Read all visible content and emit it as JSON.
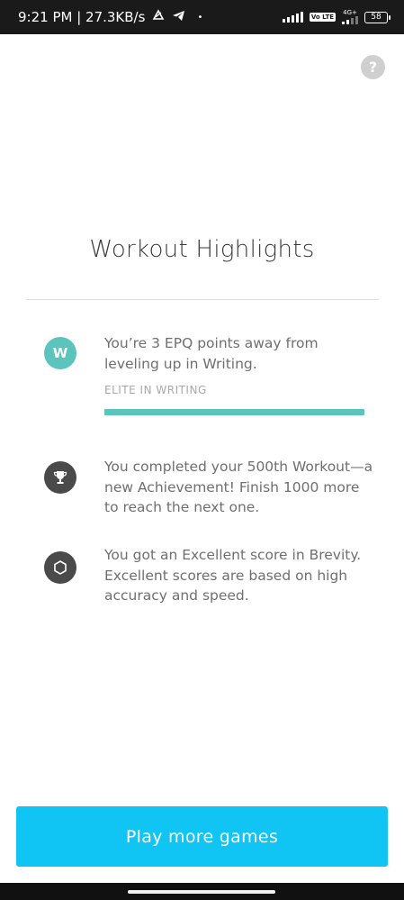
{
  "status_bar": {
    "time_speed": "9:21 PM | 27.3KB/s",
    "volte": "Vo LTE",
    "network": "4G+",
    "battery": "58"
  },
  "header": {
    "title": "Workout Highlights"
  },
  "highlights": [
    {
      "badge_letter": "W",
      "text": "You’re 3 EPQ points away from leveling up in Writing.",
      "level_label": "ELITE IN WRITING",
      "progress": 1.0,
      "icon": "writing-badge-icon",
      "color": "#5bc4bc"
    },
    {
      "text": "You completed your 500th Workout—a new Achievement! Finish 1000 more to reach the next one.",
      "icon": "trophy-icon"
    },
    {
      "text": "You got an Excellent score in Brevity. Excellent scores are based on high accuracy and speed.",
      "icon": "hexagon-icon"
    }
  ],
  "footer": {
    "play_label": "Play more games",
    "button_color": "#10c4f4"
  },
  "help": {
    "label": "?"
  }
}
